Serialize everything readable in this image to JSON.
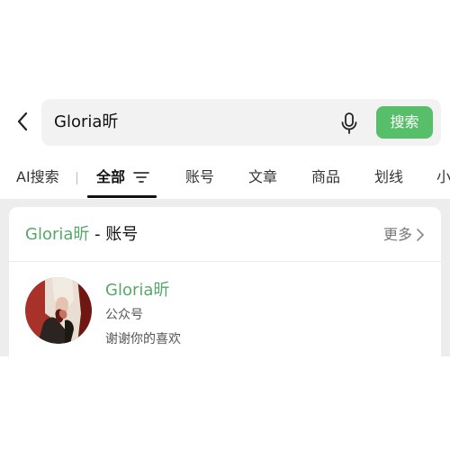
{
  "search": {
    "query": "Gloria昕",
    "button_label": "搜索"
  },
  "tabs": [
    {
      "label": "AI搜索"
    },
    {
      "label": "全部"
    },
    {
      "label": "账号"
    },
    {
      "label": "文章"
    },
    {
      "label": "商品"
    },
    {
      "label": "划线"
    },
    {
      "label": "小"
    }
  ],
  "section": {
    "title_highlight": "Gloria昕",
    "title_rest": " - 账号",
    "more_label": "更多"
  },
  "result": {
    "name": "Gloria昕",
    "type": "公众号",
    "description": "谢谢你的喜欢"
  },
  "colors": {
    "accent": "#57be6a",
    "highlight_text": "#57a86a"
  }
}
